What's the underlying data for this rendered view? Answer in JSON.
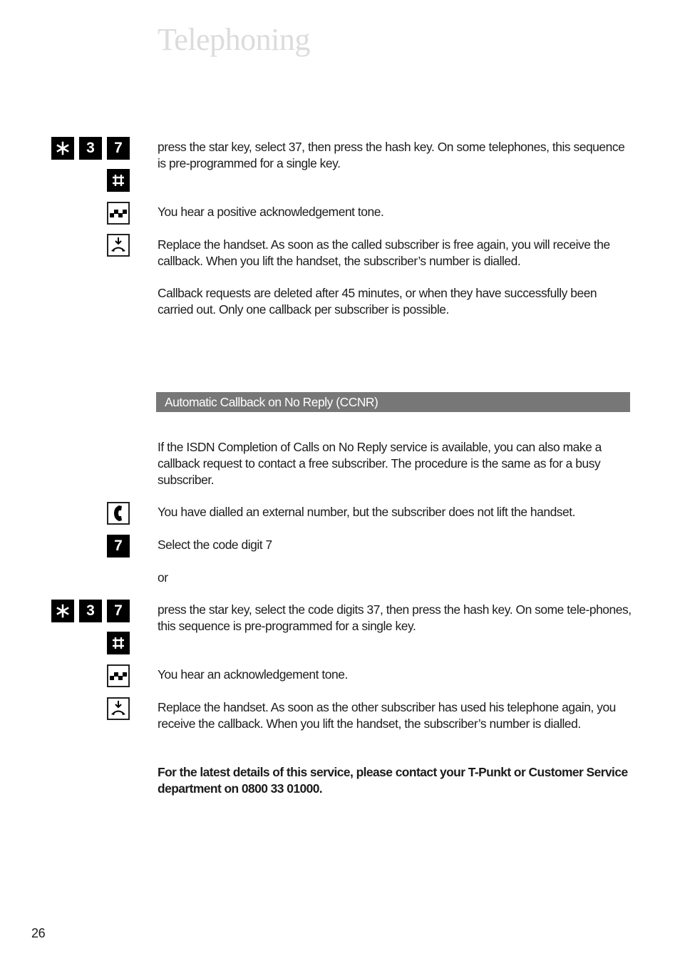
{
  "page": {
    "title": "Telephoning",
    "page_number": "26"
  },
  "section1": {
    "keys_row": [
      {
        "icon": "star-key-icon",
        "label": "*"
      },
      {
        "icon": "digit-key-icon",
        "label": "3"
      },
      {
        "icon": "digit-key-icon",
        "label": "7"
      }
    ],
    "hash_key": {
      "icon": "hash-key-icon",
      "label": "#"
    },
    "step_keys": "press the star key, select 37, then press the hash key. On some telephones, this sequence is pre-programmed for a single key.",
    "step_tone": "You hear a positive acknowledgement tone.",
    "step_replace": "Replace the handset. As soon as the called subscriber is free again, you will receive the callback. When you lift the handset, the subscriber’s number is dialled.",
    "note": "Callback requests are deleted after 45 minutes, or when they have successfully been carried out. Only one callback per subscriber is possible."
  },
  "section2": {
    "heading": "Automatic Callback on No Reply (CCNR)",
    "intro": "If the ISDN Completion of Calls on No Reply service is available, you can also make a callback request to contact a free subscriber. The procedure is the same as for a busy subscriber.",
    "step_dialled": "You have dialled an external number, but the subscriber does not lift the handset.",
    "digit_key": {
      "icon": "digit-key-icon",
      "label": "7"
    },
    "step_digit": "Select the code digit 7",
    "or": "or",
    "keys_row": [
      {
        "icon": "star-key-icon",
        "label": "*"
      },
      {
        "icon": "digit-key-icon",
        "label": "3"
      },
      {
        "icon": "digit-key-icon",
        "label": "7"
      }
    ],
    "hash_key": {
      "icon": "hash-key-icon",
      "label": "#"
    },
    "step_keys": "press the star key, select the code digits 37, then press the hash key. On some tele-phones, this sequence is pre-programmed for a single key.",
    "step_tone": "You hear an acknowledgement tone.",
    "step_replace": "Replace the handset. As soon as the other subscriber has used his telephone again, you receive the callback. When you lift the handset, the subscriber’s number is dialled.",
    "contact_note": "For the latest details of this service, please contact your T-Punkt or Customer Service department on 0800 33 01000."
  }
}
